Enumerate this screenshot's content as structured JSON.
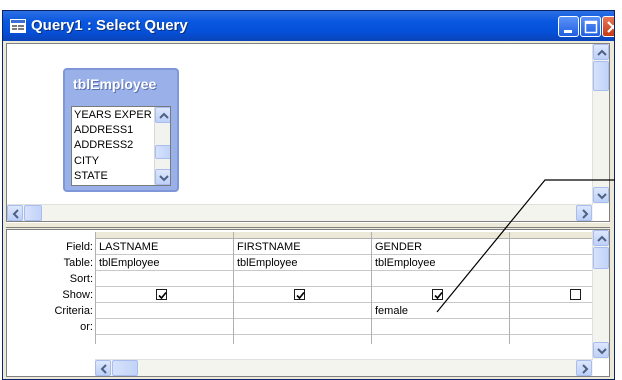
{
  "window": {
    "title": "Query1 : Select Query",
    "icon": "query-icon",
    "buttons": [
      "minimize-icon",
      "maximize-icon",
      "close-icon"
    ]
  },
  "table_box": {
    "title": "tblEmployee",
    "fields": [
      "YEARS EXPER",
      "ADDRESS1",
      "ADDRESS2",
      "CITY",
      "STATE"
    ]
  },
  "grid": {
    "row_labels": [
      "Field:",
      "Table:",
      "Sort:",
      "Show:",
      "Criteria:",
      "or:"
    ],
    "columns": [
      {
        "field": "LASTNAME",
        "table": "tblEmployee",
        "sort": "",
        "show": true,
        "criteria": "",
        "or": ""
      },
      {
        "field": "FIRSTNAME",
        "table": "tblEmployee",
        "sort": "",
        "show": true,
        "criteria": "",
        "or": ""
      },
      {
        "field": "GENDER",
        "table": "tblEmployee",
        "sort": "",
        "show": true,
        "criteria": "female",
        "or": ""
      },
      {
        "field": "",
        "table": "",
        "sort": "",
        "show": false,
        "criteria": "",
        "or": ""
      }
    ]
  },
  "colors": {
    "titlebar": "#0a58e0",
    "tablebox": "#9ab0e8",
    "window_bg": "#ece9d8"
  }
}
